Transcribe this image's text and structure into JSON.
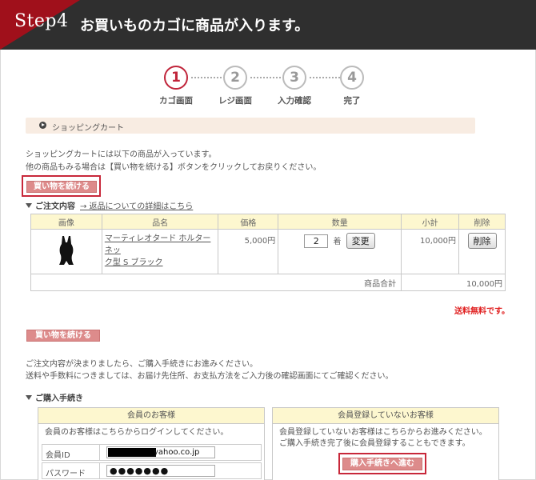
{
  "header": {
    "step_label": "Step4",
    "title": "お買いものカゴに商品が入ります。"
  },
  "steps": [
    {
      "num": "1",
      "label": "カゴ画面",
      "active": true
    },
    {
      "num": "2",
      "label": "レジ画面",
      "active": false
    },
    {
      "num": "3",
      "label": "入力確認",
      "active": false
    },
    {
      "num": "4",
      "label": "完了",
      "active": false
    }
  ],
  "section": {
    "title": "ショッピングカート"
  },
  "intro": {
    "line1": "ショッピングカートには以下の商品が入っています。",
    "line2": "他の商品もみる場合は【買い物を続ける】ボタンをクリックしてお戻りください。"
  },
  "continue_button": "買い物を続ける",
  "order": {
    "heading": "ご注文内容",
    "return_link": "→ 返品についての詳細はこちら"
  },
  "cart": {
    "headers": [
      "画像",
      "品名",
      "価格",
      "数量",
      "小計",
      "削除"
    ],
    "item": {
      "image_icon": "swimsuit-icon",
      "name_line1": "マーティレオタード ホルターネッ",
      "name_line2": "ク型 S ブラック",
      "price": "5,000円",
      "quantity": "2",
      "unit": "着",
      "change_label": "変更",
      "subtotal": "10,000円",
      "delete_label": "削除"
    },
    "total_label": "商品合計",
    "total_value": "10,000円"
  },
  "shipping_note": "送料無料です。",
  "proceed_text": {
    "line1": "ご注文内容が決まりましたら、ご購入手続きにお進みください。",
    "line2": "送料や手数料につきましては、お届け先住所、お支払方法をご入力後の確認画面にてご確認ください。"
  },
  "purchase": {
    "heading": "ご購入手続き",
    "member": {
      "title": "会員のお客様",
      "desc": "会員のお客様はこちらからログインしてください。",
      "id_label": "会員ID",
      "id_value": "yahoo.co.jp",
      "password_label": "パスワード",
      "password_value": "●●●●●●●"
    },
    "guest": {
      "title": "会員登録していないお客様",
      "desc1": "会員登録していないお客様はこちらからお進みください。",
      "desc2": "ご購入手続き完了後に会員登録することもできます。",
      "button": "購入手続きへ進む"
    }
  },
  "colors": {
    "accent": "#c0243a",
    "pink_button": "#dd8b8b",
    "header_bg": "#2f2f2f",
    "table_header": "#fdf7cf"
  }
}
